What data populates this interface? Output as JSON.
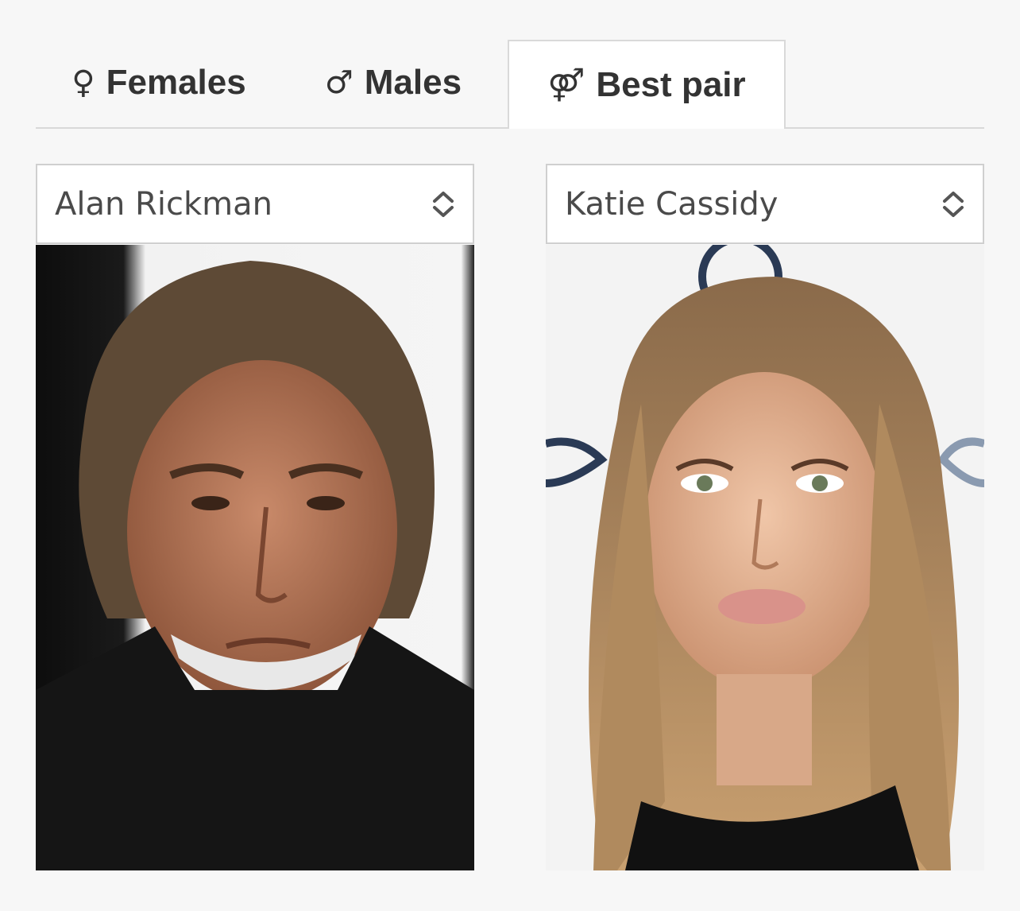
{
  "tabs": [
    {
      "symbol": "♀",
      "label": "Females",
      "active": false
    },
    {
      "symbol": "♂",
      "label": "Males",
      "active": false
    },
    {
      "symbol": "⚤",
      "label": "Best pair",
      "active": true
    }
  ],
  "selectors": {
    "left": {
      "value": "Alan Rickman"
    },
    "right": {
      "value": "Katie Cassidy"
    }
  },
  "icons": {
    "select_arrow": "chevron-up-down-icon"
  },
  "colors": {
    "background": "#f7f7f7",
    "tab_text": "#333333",
    "border": "#d9d9d9"
  }
}
